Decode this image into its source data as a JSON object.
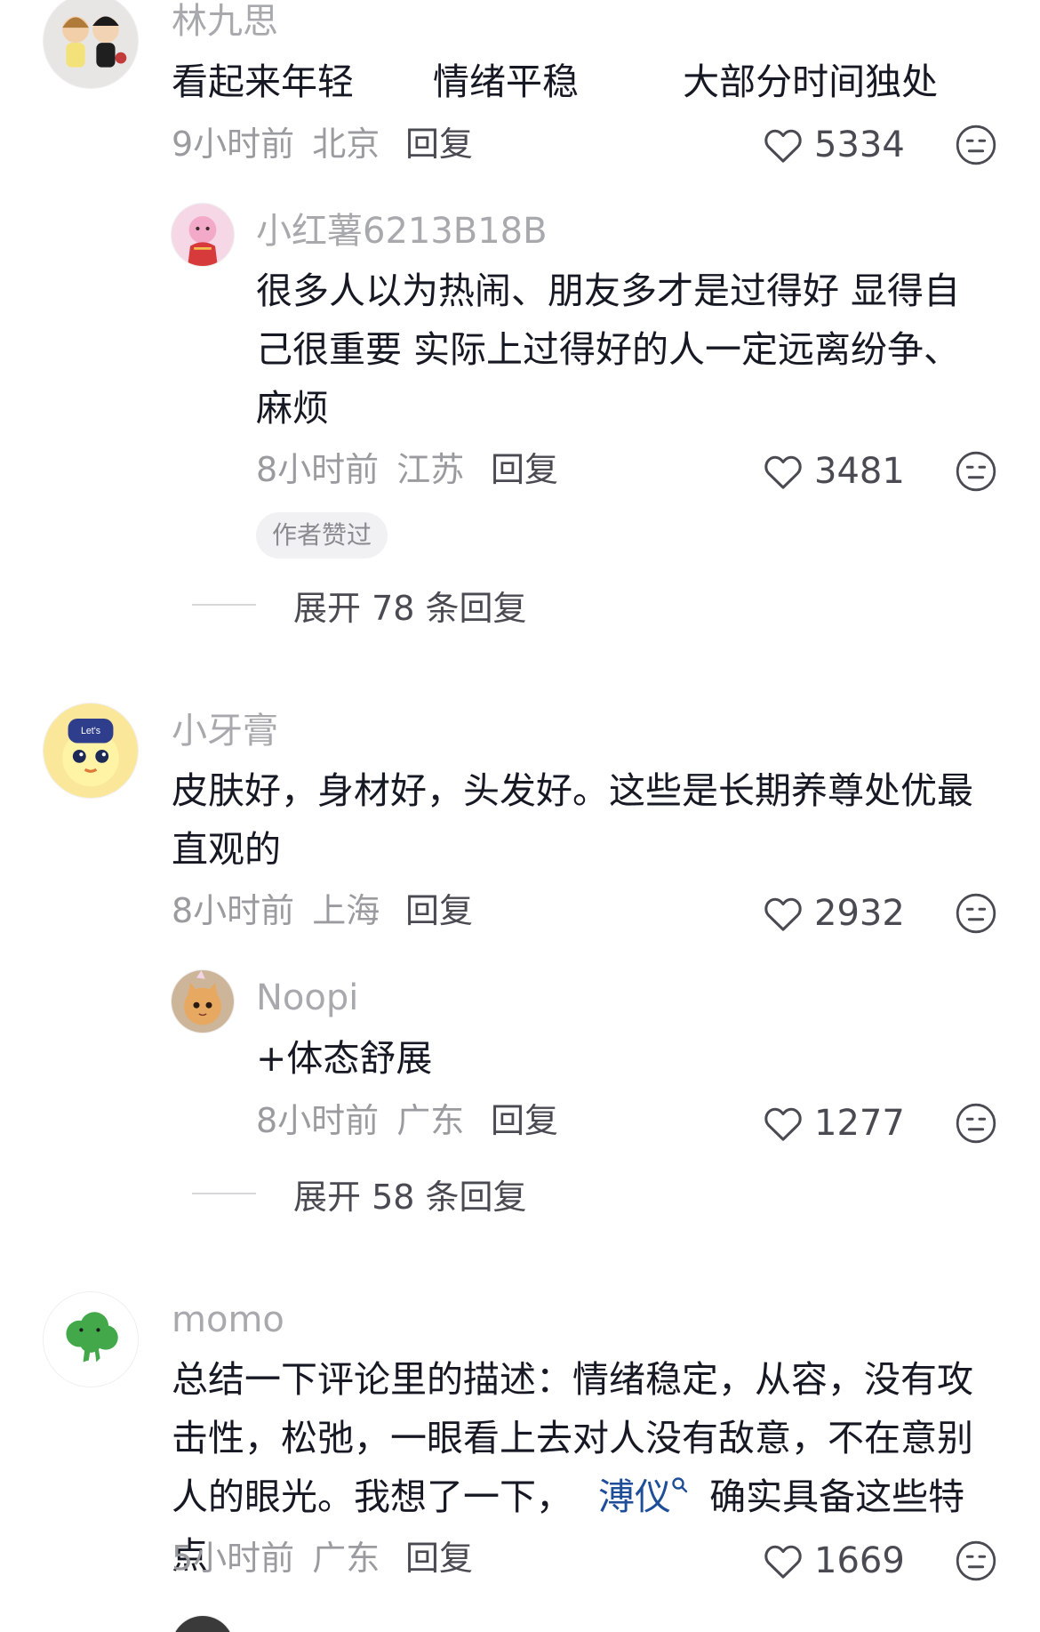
{
  "comments": [
    {
      "name": "林九思",
      "tags": [
        "看起来年轻",
        "情绪平稳",
        "大部分时间独处"
      ],
      "time": "9小时前",
      "location": "北京",
      "reply_label": "回复",
      "likes": "5334",
      "replies": [
        {
          "name": "小红薯6213B18B",
          "text": "很多人以为热闹、朋友多才是过得好 显得自己很重要 实际上过得好的人一定远离纷争、麻烦",
          "time": "8小时前",
          "location": "江苏",
          "reply_label": "回复",
          "likes": "3481",
          "badge": "作者赞过"
        }
      ],
      "expand_label": "展开 78 条回复"
    },
    {
      "name": "小牙膏",
      "text": "皮肤好，身材好，头发好。这些是长期养尊处优最直观的",
      "time": "8小时前",
      "location": "上海",
      "reply_label": "回复",
      "likes": "2932",
      "replies": [
        {
          "name": "Noopi",
          "text": "+体态舒展",
          "time": "8小时前",
          "location": "广东",
          "reply_label": "回复",
          "likes": "1277"
        }
      ],
      "expand_label": "展开 58 条回复"
    },
    {
      "name": "momo",
      "text_before": "总结一下评论里的描述：情绪稳定，从容，没有攻击性，松弛，一眼看上去对人没有敌意，不在意别人的眼光。我想了一下，",
      "mention": "溥仪",
      "text_after": "确实具备这些特点",
      "time": "5小时前",
      "location": "广东",
      "reply_label": "回复",
      "likes": "1669"
    }
  ],
  "icons": {
    "like": "heart-outline-icon",
    "dislike": "meh-face-icon",
    "search": "search-icon"
  },
  "colors": {
    "meta": "#9a9b9f",
    "mention": "#1f4e99",
    "text": "#161823"
  }
}
